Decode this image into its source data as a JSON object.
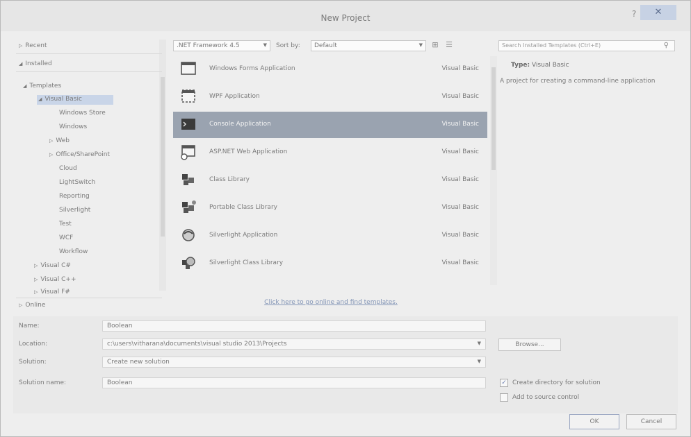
{
  "window": {
    "title": "New Project",
    "help": "?",
    "close": "✕"
  },
  "tree": {
    "recent": "Recent",
    "installed": "Installed",
    "templates": "Templates",
    "visual_basic": "Visual Basic",
    "children": [
      "Windows Store",
      "Windows",
      "Web",
      "Office/SharePoint",
      "Cloud",
      "LightSwitch",
      "Reporting",
      "Silverlight",
      "Test",
      "WCF",
      "Workflow"
    ],
    "visual_csharp": "Visual C#",
    "visual_cpp": "Visual C++",
    "visual_fsharp": "Visual F#",
    "online": "Online"
  },
  "toolbar": {
    "framework": ".NET Framework 4.5",
    "sortby_label": "Sort by:",
    "sortby_value": "Default",
    "search_placeholder": "Search Installed Templates (Ctrl+E)"
  },
  "templates": [
    {
      "name": "Windows Forms Application",
      "lang": "Visual Basic",
      "icon": "forms-icon"
    },
    {
      "name": "WPF Application",
      "lang": "Visual Basic",
      "icon": "wpf-icon"
    },
    {
      "name": "Console Application",
      "lang": "Visual Basic",
      "icon": "console-icon"
    },
    {
      "name": "ASP.NET Web Application",
      "lang": "Visual Basic",
      "icon": "web-icon"
    },
    {
      "name": "Class Library",
      "lang": "Visual Basic",
      "icon": "class-library-icon"
    },
    {
      "name": "Portable Class Library",
      "lang": "Visual Basic",
      "icon": "portable-class-library-icon"
    },
    {
      "name": "Silverlight Application",
      "lang": "Visual Basic",
      "icon": "silverlight-app-icon"
    },
    {
      "name": "Silverlight Class Library",
      "lang": "Visual Basic",
      "icon": "silverlight-library-icon"
    }
  ],
  "selected_template_index": 2,
  "online_link": "Click here to go online and find templates.",
  "description": {
    "type_label": "Type:",
    "type_value": "Visual Basic",
    "text": "A project for creating a command-line application"
  },
  "form": {
    "name_label": "Name:",
    "name_value": "Boolean",
    "location_label": "Location:",
    "location_value": "c:\\users\\vitharana\\documents\\visual studio 2013\\Projects",
    "solution_label": "Solution:",
    "solution_value": "Create new solution",
    "solution_name_label": "Solution name:",
    "solution_name_value": "Boolean",
    "browse_label": "Browse...",
    "create_dir_label": "Create directory for solution",
    "create_dir_checked": true,
    "source_control_label": "Add to source control",
    "source_control_checked": false
  },
  "buttons": {
    "ok": "OK",
    "cancel": "Cancel"
  }
}
